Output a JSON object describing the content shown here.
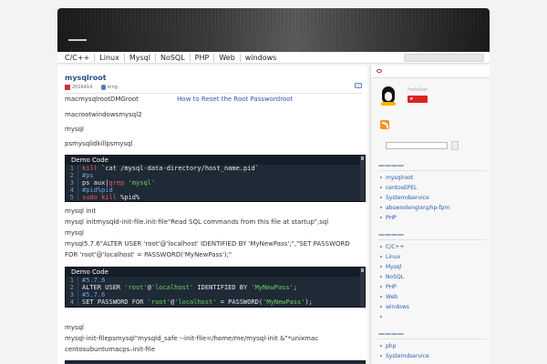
{
  "header": {
    "description": "."
  },
  "nav": {
    "items": [
      "C/C++",
      "Linux",
      "Mysql",
      "NoSQL",
      "PHP",
      "Web",
      "windows"
    ]
  },
  "post": {
    "title": "mysqlroot",
    "date": "2016414",
    "author": "king",
    "p1": "macmysqlrootDMGroot",
    "p1_link": "How to Reset the Root Passwordroot",
    "p2": "macrootwindowsmysql2",
    "p3": "mysql",
    "p4": "psmysqlidkillpsmysql",
    "code1_title": "Demo Code",
    "code1": [
      {
        "n": "1",
        "parts": [
          [
            "k",
            "kill "
          ],
          [
            "",
            "`cat /mysql-data-directory/host_name.pid`"
          ]
        ]
      },
      {
        "n": "2",
        "parts": [
          [
            "c",
            "#ps"
          ]
        ]
      },
      {
        "n": "3",
        "parts": [
          [
            "",
            "ps aux|"
          ],
          [
            "k",
            "grep "
          ],
          [
            "g",
            "'mysql'"
          ]
        ]
      },
      {
        "n": "4",
        "parts": [
          [
            "c",
            "#pid%pid"
          ]
        ]
      },
      {
        "n": "5",
        "parts": [
          [
            "k",
            "sudo kill "
          ],
          [
            "",
            "%pid%"
          ]
        ]
      }
    ],
    "p5": "mysql init",
    "p6": "mysql initmysqld-init-file.init-file\"Read SQL commands from this file at startup\",sql",
    "p7": "mysql",
    "p8": "mysql5.7.6\"ALTER USER 'root'@'localhost' IDENTIFIED BY 'MyNewPass';\",\"SET PASSWORD",
    "p9": "FOR 'root'@'localhost' = PASSWORD('MyNewPass');\"",
    "code2_title": "Demo Code",
    "code2": [
      {
        "n": "1",
        "parts": [
          [
            "c",
            "#5.7.6"
          ]
        ]
      },
      {
        "n": "2",
        "parts": [
          [
            "",
            "ALTER USER "
          ],
          [
            "g",
            "'root'"
          ],
          [
            "",
            "@"
          ],
          [
            "g",
            "'localhost'"
          ],
          [
            "",
            " IDENTIFIED BY "
          ],
          [
            "g",
            "'MyNewPass'"
          ],
          [
            "",
            ";"
          ]
        ]
      },
      {
        "n": "3",
        "parts": [
          [
            "c",
            "#5.7.6"
          ]
        ]
      },
      {
        "n": "4",
        "parts": [
          [
            "",
            "SET PASSWORD FOR "
          ],
          [
            "g",
            "'root'"
          ],
          [
            "",
            "@"
          ],
          [
            "g",
            "'localhost'"
          ],
          [
            "",
            " = PASSWORD("
          ],
          [
            "g",
            "'MyNewPass'"
          ],
          [
            "",
            ");"
          ]
        ]
      }
    ],
    "p10": "mysql",
    "p11": "mysql-init-filepsmysql\"mysqld_safe --init-file=/home/me/mysql-init &\"*unixmac",
    "p12": "centosubuntumacps–init-file"
  },
  "sidebar": {
    "name": "Fedallian",
    "flag_text": "★",
    "widget1": {
      "title": "————",
      "items": [
        "mysqlroot",
        "centosEPEL",
        "Systemdservice",
        "abswoolengixnphp-fpm",
        "PHP"
      ]
    },
    "widget2": {
      "title": "————",
      "items": [
        "C/C++",
        "Linux",
        "Mysql",
        "NoSQL",
        "PHP",
        "Web",
        "windows",
        ""
      ]
    },
    "widget3": {
      "title": "————",
      "items": [
        "php",
        "Systemdservice"
      ]
    }
  }
}
